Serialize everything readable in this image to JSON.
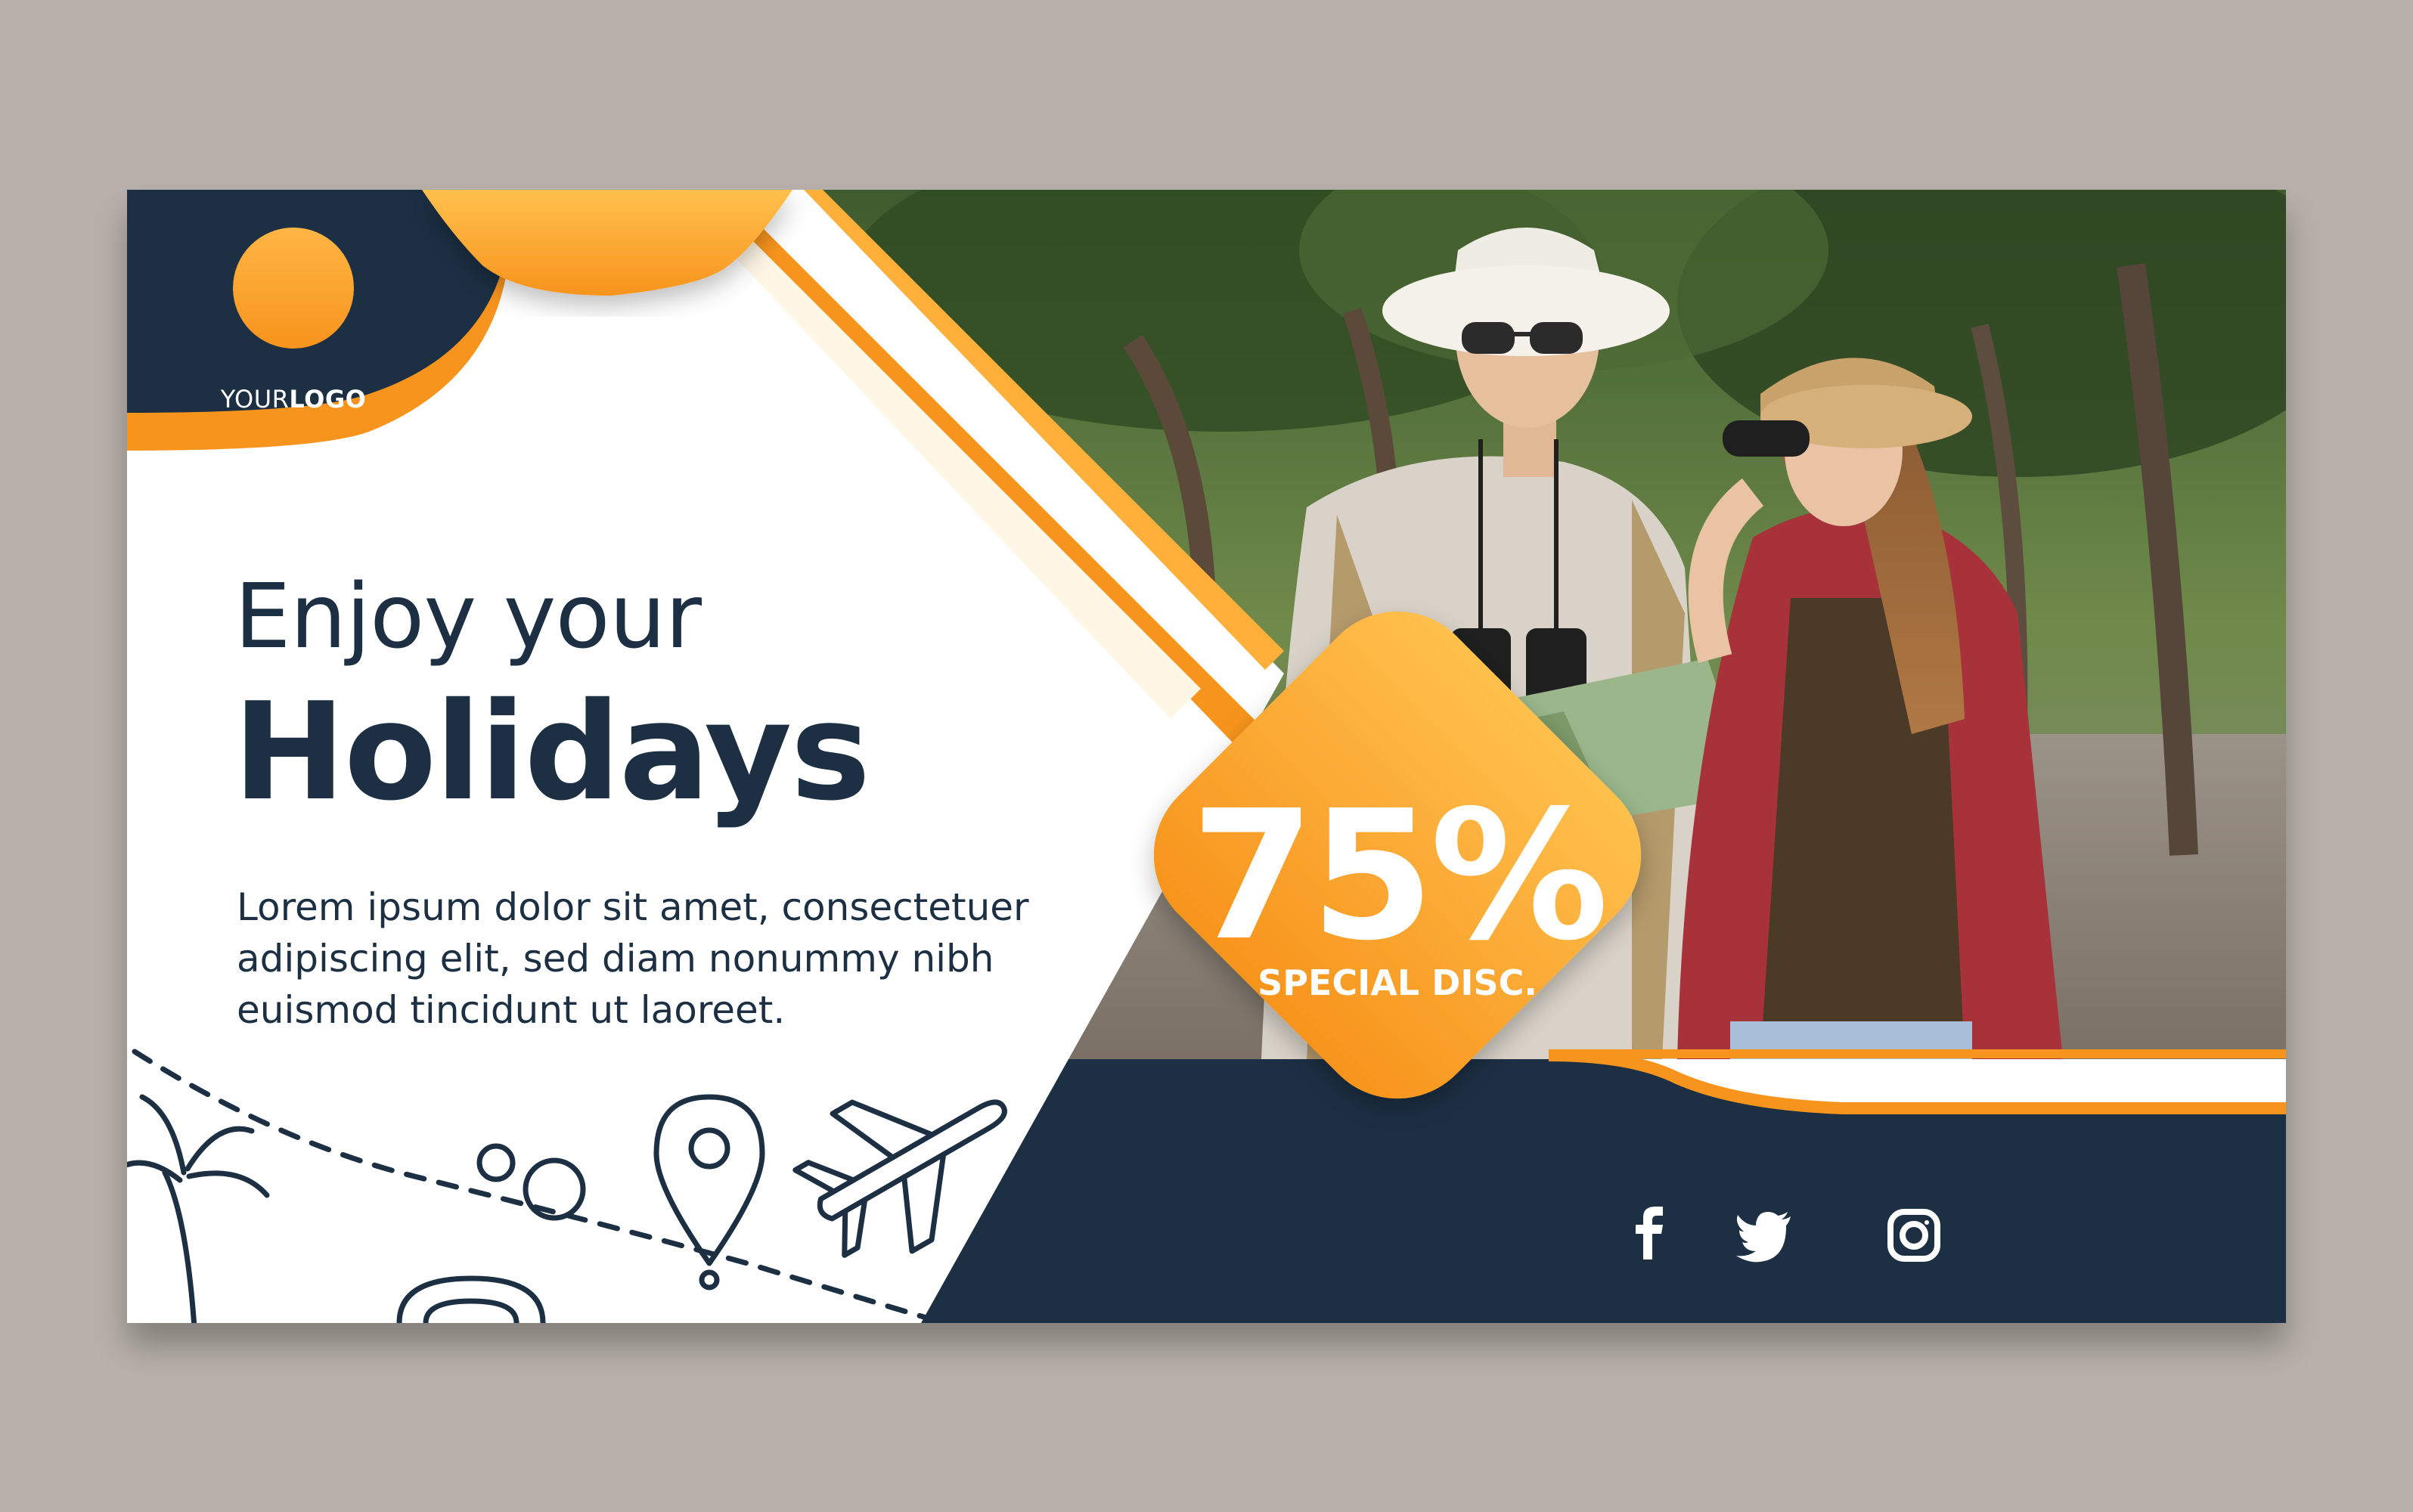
{
  "logo": {
    "prefix": "YOUR",
    "suffix": "LOGO"
  },
  "headline": {
    "line1": "Enjoy your",
    "line2": "Holidays"
  },
  "body": {
    "line1": "Lorem ipsum dolor sit amet, consectetuer",
    "line2": "adipiscing elit, sed diam nonummy nibh",
    "line3": "euismod tincidunt ut laoreet."
  },
  "discount": {
    "value": "75%",
    "label": "SPECIAL DISC."
  },
  "social": [
    "facebook-icon",
    "twitter-icon",
    "instagram-icon"
  ],
  "colors": {
    "navy": "#1c2f43",
    "orange": "#f7941d",
    "orange_light": "#ffc04d",
    "background": "#b8b1ab",
    "white": "#ffffff"
  },
  "icons": [
    "palm-tree-icon",
    "bubbles-icon",
    "location-pin-icon",
    "airplane-icon",
    "sun-arc-icon",
    "dashed-route-icon"
  ]
}
